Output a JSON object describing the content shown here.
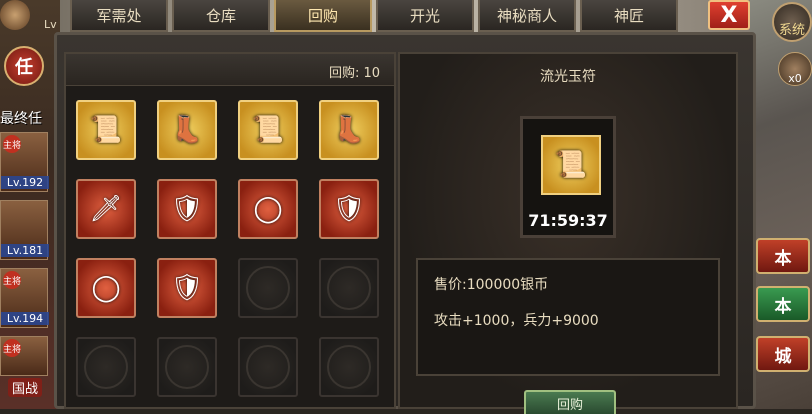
{
  "tabs": [
    {
      "label": "军需处"
    },
    {
      "label": "仓库"
    },
    {
      "label": "回购"
    },
    {
      "label": "开光"
    },
    {
      "label": "神秘商人"
    },
    {
      "label": "神匠"
    }
  ],
  "close_label": "X",
  "left": {
    "lv_label": "Lv",
    "task_icon_label": "任",
    "task_label": "最终任",
    "generals": [
      {
        "tag": "主将",
        "lv": "Lv.192"
      },
      {
        "tag": "",
        "lv": "Lv.181"
      },
      {
        "tag": "主将",
        "lv": "Lv.194"
      },
      {
        "tag": "主将",
        "lv": ""
      }
    ],
    "guozhan_label": "国战"
  },
  "right": {
    "system_label": "系统",
    "icon_label": "x0",
    "buttons": [
      {
        "label": "本",
        "color": "red"
      },
      {
        "label": "本",
        "color": "green"
      },
      {
        "label": "城",
        "color": "red"
      }
    ]
  },
  "grid": {
    "buyback_label": "回购: 10",
    "slots": [
      {
        "type": "gold",
        "icon": "scroll-icon",
        "glyph": "📜"
      },
      {
        "type": "gold",
        "icon": "boots-icon",
        "glyph": "👢"
      },
      {
        "type": "gold",
        "icon": "scroll-icon",
        "glyph": "📜"
      },
      {
        "type": "gold",
        "icon": "boots-icon",
        "glyph": "👢"
      },
      {
        "type": "red",
        "icon": "spear-icon",
        "glyph": "🗡"
      },
      {
        "type": "red",
        "icon": "armor-icon",
        "glyph": "🛡"
      },
      {
        "type": "red",
        "icon": "mirror-icon",
        "glyph": "◯"
      },
      {
        "type": "red",
        "icon": "armor-icon",
        "glyph": "🛡"
      },
      {
        "type": "red",
        "icon": "mirror-icon",
        "glyph": "◯"
      },
      {
        "type": "red",
        "icon": "armor-icon",
        "glyph": "🛡"
      },
      {
        "type": "empty",
        "icon": "empty-slot-icon",
        "glyph": ""
      },
      {
        "type": "empty",
        "icon": "empty-slot-icon",
        "glyph": ""
      },
      {
        "type": "empty",
        "icon": "empty-slot-icon",
        "glyph": ""
      },
      {
        "type": "empty",
        "icon": "empty-slot-icon",
        "glyph": ""
      },
      {
        "type": "empty",
        "icon": "empty-slot-icon",
        "glyph": ""
      },
      {
        "type": "empty",
        "icon": "empty-slot-icon",
        "glyph": ""
      }
    ]
  },
  "detail": {
    "item_name": "流光玉符",
    "item_glyph": "📜",
    "timer": "71:59:37",
    "price": "售价:100000银币",
    "attributes": "攻击+1000，兵力+9000",
    "buy_label": "回购"
  },
  "colors": {
    "accent_gold": "#f0d080",
    "quality_gold": "#c89020",
    "quality_red": "#8a2010",
    "close_red": "#e04030"
  }
}
